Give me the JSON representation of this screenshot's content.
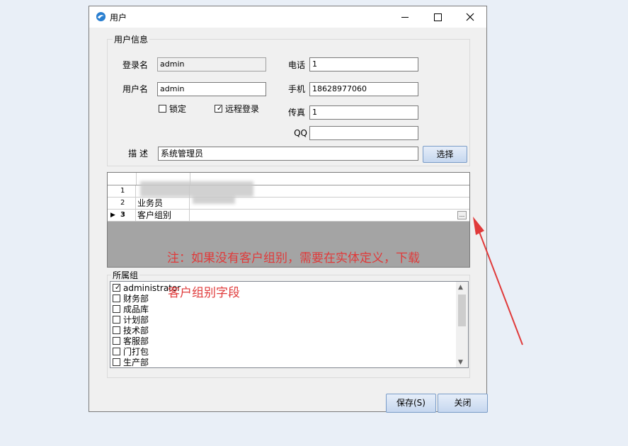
{
  "window": {
    "title": "用户"
  },
  "user_info": {
    "group_title": "用户信息",
    "login_name": {
      "label": "登录名",
      "value": "admin"
    },
    "user_name": {
      "label": "用户名",
      "value": "admin"
    },
    "phone": {
      "label": "电话",
      "value": "1"
    },
    "mobile": {
      "label": "手机",
      "value": "18628977060"
    },
    "fax": {
      "label": "传真",
      "value": "1"
    },
    "qq": {
      "label": "QQ",
      "value": ""
    },
    "locked": {
      "label": "锁定",
      "checked": false
    },
    "remote_login": {
      "label": "远程登录",
      "checked": true
    },
    "description": {
      "label": "描 述",
      "value": "系统管理员"
    },
    "choose_button": "选择"
  },
  "grid": {
    "rows": [
      {
        "num": "1",
        "value": ""
      },
      {
        "num": "2",
        "value": "业务员"
      },
      {
        "num": "3",
        "value": "客户组别",
        "current": true
      }
    ],
    "ellipsis": "..."
  },
  "department": {
    "group_title": "所属组",
    "items": [
      {
        "label": "administrator",
        "checked": true
      },
      {
        "label": "财务部",
        "checked": false
      },
      {
        "label": "成品库",
        "checked": false
      },
      {
        "label": "计划部",
        "checked": false
      },
      {
        "label": "技术部",
        "checked": false
      },
      {
        "label": "客服部",
        "checked": false
      },
      {
        "label": "门打包",
        "checked": false
      },
      {
        "label": "生产部",
        "checked": false
      }
    ]
  },
  "footer": {
    "save": "保存(S)",
    "close": "关闭"
  },
  "annotation": {
    "line1": "注：如果没有客户组别，需要在实体定义，下载",
    "line2": "客户组别字段",
    "color": "#e03a3a"
  }
}
